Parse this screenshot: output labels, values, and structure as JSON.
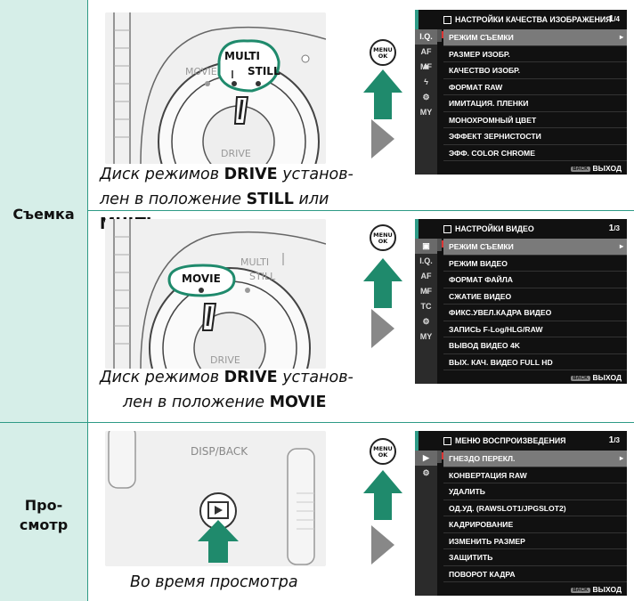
{
  "rows": {
    "shooting": {
      "label": "Съемка"
    },
    "playback": {
      "label_line1": "Про-",
      "label_line2": "смотр"
    }
  },
  "panels": {
    "still": {
      "dial_labels": {
        "multi": "MULTI",
        "still": "STILL",
        "movie": "MOVIE",
        "drive": "DRIVE"
      },
      "caption": {
        "p1": "Диск режимов ",
        "b1": "DRIVE",
        "p2": " установ-",
        "p3": "лен в положение ",
        "b2": "STILL",
        "p4": " или ",
        "b3": "MULTI"
      }
    },
    "movie": {
      "dial_labels": {
        "multi": "MULTI",
        "still": "STILL",
        "movie": "MOVIE",
        "drive": "DRIVE"
      },
      "caption": {
        "p1": "Диск режимов ",
        "b1": "DRIVE",
        "p2": " установ-",
        "p3": "лен в положение ",
        "b2": "MOVIE"
      }
    },
    "playback": {
      "dial_labels": {
        "disp_back": "DISP/BACK"
      },
      "caption": "Во время просмотра"
    }
  },
  "menu_button": {
    "line1": "MENU",
    "line2": "OK"
  },
  "screens": {
    "image_quality": {
      "title": "НАСТРОЙКИ КАЧЕСТВА ИЗОБРАЖЕНИЯ",
      "page": "1",
      "page_total": "/4",
      "tabs": [
        "I.Q.",
        "AF MF",
        "■",
        "ϟ",
        "⚙",
        "MY"
      ],
      "items": [
        "РЕЖИМ СЪЕМКИ",
        "РАЗМЕР ИЗОБР.",
        "КАЧЕСТВО ИЗОБР.",
        "ФОРМАТ RAW",
        "ИМИТАЦИЯ. ПЛЕНКИ",
        "МОНОХРОМНЫЙ ЦВЕТ",
        "ЭФФЕКТ ЗЕРНИСТОСТИ",
        "ЭФФ. COLOR CHROME"
      ],
      "back_badge": "BACK",
      "back_label": "ВЫХОД"
    },
    "video": {
      "title": "НАСТРОЙКИ ВИДЕО",
      "page": "1",
      "page_total": "/3",
      "tabs": [
        "▣",
        "I.Q.",
        "AF MF",
        "◖",
        "TC",
        "⚙",
        "MY"
      ],
      "items": [
        "РЕЖИМ СЪЕМКИ",
        "РЕЖИМ ВИДЕО",
        "ФОРМАТ ФАЙЛА",
        "СЖАТИЕ ВИДЕО",
        "ФИКС.УВЕЛ.КАДРА ВИДЕО",
        "ЗАПИСЬ F-Log/HLG/RAW",
        "ВЫВОД ВИДЕО 4K",
        "ВЫХ. КАЧ. ВИДЕО FULL HD"
      ],
      "back_badge": "BACK",
      "back_label": "ВЫХОД"
    },
    "playback": {
      "title": "МЕНЮ ВОСПРОИЗВЕДЕНИЯ",
      "page": "1",
      "page_total": "/3",
      "tabs": [
        "▶",
        "⚙"
      ],
      "items": [
        "ГНЕЗДО ПЕРЕКЛ.",
        "КОНВЕРТАЦИЯ RAW",
        "УДАЛИТЬ",
        "ОД.УД. (RAWSLOT1/JPGSLOT2)",
        "КАДРИРОВАНИЕ",
        "ИЗМЕНИТЬ РАЗМЕР",
        "ЗАЩИТИТЬ",
        "ПОВОРОТ КАДРА"
      ],
      "back_badge": "BACK",
      "back_label": "ВЫХОД"
    }
  },
  "colors": {
    "accent": "#2e9a86",
    "sidebar": "#d6eee8",
    "arrow_green": "#1f8a6c",
    "arrow_gray": "#888888"
  }
}
